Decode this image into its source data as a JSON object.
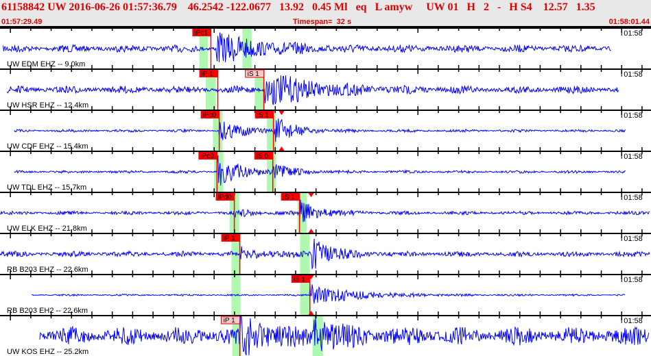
{
  "header": {
    "title": "61158842 UW 2016-06-26 01:57:36.79    46.2542 -122.0677   13.92   0.45 Ml   eq   L amyw     UW 01   H   2   -   H S4    12.57   1.35",
    "start_time": "01:57:29.49",
    "timespan": "Timespan=  32 s",
    "end_time": "01:58:01.44"
  },
  "colors": {
    "trace": "#0000ff",
    "pick": "#ff0000",
    "pick_weak": "#f8c8c8",
    "window": "#b0f8b0",
    "header_text": "#e00000"
  },
  "timescale": {
    "span_seconds": 31.95,
    "first_major_tick_seconds": 0.51,
    "minute_label": "01:58"
  },
  "channels": [
    {
      "label": "UW EDM EHZ -- 9.0km",
      "trace_start": 0.15,
      "trace_end": 30.0,
      "noise": 4,
      "burst_t": 10.6,
      "burst_amp": 22,
      "windows": [
        [
          9.78,
          10.2
        ],
        [
          11.9,
          12.35
        ]
      ],
      "picks": [
        {
          "label": "iPc1",
          "t": 10.35,
          "weak": false
        }
      ],
      "marks": []
    },
    {
      "label": "UW HSR EHZ -- 12.4km",
      "trace_start": 0.35,
      "trace_end": 30.35,
      "noise": 4,
      "burst_t": 12.95,
      "burst_amp": 26,
      "windows": [
        [
          10.1,
          10.6
        ],
        [
          12.5,
          12.95
        ]
      ],
      "picks": [
        {
          "label": "iP 1",
          "t": 10.69,
          "weak": false
        },
        {
          "label": "iS 1",
          "t": 12.95,
          "weak": true
        }
      ],
      "marks": []
    },
    {
      "label": "UW CDF EHZ -- 15.4km",
      "trace_start": 0.7,
      "trace_end": 30.7,
      "noise": 1.5,
      "burst_t": 10.76,
      "burst_amp": 16,
      "s_t": 13.42,
      "s_amp": 22,
      "windows": [
        [
          10.45,
          10.92
        ],
        [
          13.1,
          13.55
        ]
      ],
      "picks": [
        {
          "label": "iPc0",
          "t": 10.76,
          "weak": false
        },
        {
          "label": "iS 1",
          "t": 13.42,
          "weak": false
        }
      ],
      "marks": [
        13.82
      ]
    },
    {
      "label": "UW TDL EHZ -- 15.7km",
      "trace_start": 0.7,
      "trace_end": 30.7,
      "noise": 1.5,
      "burst_t": 10.65,
      "burst_amp": 24,
      "s_t": 13.39,
      "s_amp": 10,
      "windows": [
        [
          10.5,
          10.96
        ],
        [
          13.1,
          13.55
        ]
      ],
      "picks": [
        {
          "label": "iPc0",
          "t": 10.65,
          "weak": false
        },
        {
          "label": "iS 0",
          "t": 13.39,
          "weak": false
        }
      ],
      "marks": []
    },
    {
      "label": "UW ELK EHZ -- 21.8km",
      "trace_start": 0.0,
      "trace_end": 31.9,
      "noise": 2,
      "burst_t": 11.5,
      "burst_amp": 4,
      "s_t": 14.7,
      "s_amp": 18,
      "windows": [
        [
          11.27,
          11.74
        ],
        [
          14.6,
          15.05
        ]
      ],
      "picks": [
        {
          "label": "iPd0",
          "t": 11.5,
          "weak": false
        },
        {
          "label": "iS 1",
          "t": 14.7,
          "weak": false
        }
      ],
      "marks": [
        15.27
      ]
    },
    {
      "label": "RB B203 EHZ -- 22.6km",
      "trace_start": 0.0,
      "trace_end": 31.9,
      "noise": 3,
      "burst_t": 11.77,
      "burst_amp": 8,
      "s_t": 15.3,
      "s_amp": 26,
      "windows": [
        [
          11.36,
          11.8
        ],
        [
          14.73,
          15.2
        ]
      ],
      "picks": [
        {
          "label": "iP 1",
          "t": 11.77,
          "weak": false
        }
      ],
      "marks": []
    },
    {
      "label": "RB B203 EH2 -- 22.6km",
      "trace_start": 1.55,
      "trace_end": 30.7,
      "noise": 1,
      "burst_t": 15.21,
      "burst_amp": 16,
      "windows": [
        [
          11.36,
          11.8
        ],
        [
          14.73,
          15.2
        ]
      ],
      "picks": [
        {
          "label": "iS 1",
          "t": 15.21,
          "weak": false
        }
      ],
      "marks": [
        15.27
      ]
    },
    {
      "label": "UW KOS EHZ -- 25.2km",
      "trace_start": 1.95,
      "trace_end": 31.85,
      "noise": 10,
      "burst_t": 11.77,
      "burst_amp": 28,
      "s_t": 15.4,
      "s_amp": 30,
      "windows": [
        [
          11.4,
          11.85
        ],
        [
          15.34,
          15.85
        ]
      ],
      "picks": [
        {
          "label": "iP 1",
          "t": 11.77,
          "weak": true
        }
      ],
      "marks": []
    }
  ]
}
